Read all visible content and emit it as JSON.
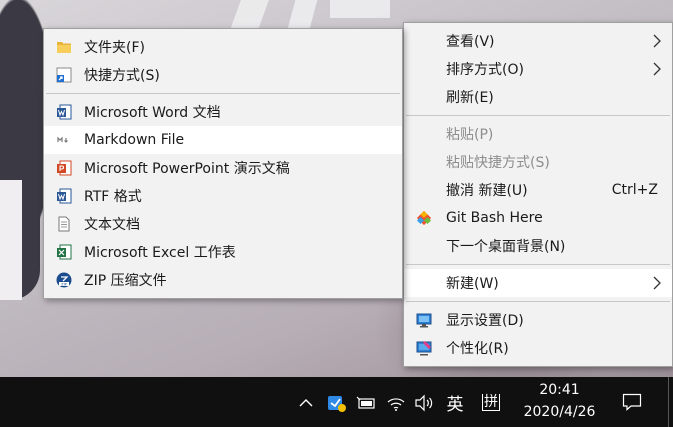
{
  "colors": {
    "menu_bg": "#f2f2f2",
    "menu_hover": "#ffffff",
    "disabled_text": "#8d8d8d",
    "taskbar_bg": "#101010"
  },
  "context_menu": {
    "items": [
      {
        "label": "查看(V)",
        "has_submenu": true
      },
      {
        "label": "排序方式(O)",
        "has_submenu": true
      },
      {
        "label": "刷新(E)"
      },
      {
        "label": "粘贴(P)",
        "disabled": true
      },
      {
        "label": "粘贴快捷方式(S)",
        "disabled": true
      },
      {
        "label": "撤消 新建(U)",
        "shortcut": "Ctrl+Z"
      },
      {
        "label": "Git Bash Here",
        "icon": "git-icon"
      },
      {
        "label": "下一个桌面背景(N)"
      },
      {
        "label": "新建(W)",
        "has_submenu": true,
        "highlighted": true
      },
      {
        "label": "显示设置(D)",
        "icon": "display-icon"
      },
      {
        "label": "个性化(R)",
        "icon": "personalize-icon"
      }
    ]
  },
  "new_submenu": {
    "items": [
      {
        "label": "文件夹(F)",
        "icon": "folder-icon"
      },
      {
        "label": "快捷方式(S)",
        "icon": "shortcut-icon"
      },
      {
        "label": "Microsoft Word 文档",
        "icon": "word-icon"
      },
      {
        "label": "Markdown File",
        "icon": "markdown-icon",
        "highlighted": true
      },
      {
        "label": "Microsoft PowerPoint 演示文稿",
        "icon": "powerpoint-icon"
      },
      {
        "label": "RTF 格式",
        "icon": "rtf-icon"
      },
      {
        "label": "文本文档",
        "icon": "text-document-icon"
      },
      {
        "label": "Microsoft Excel 工作表",
        "icon": "excel-icon"
      },
      {
        "label": "ZIP 压缩文件",
        "icon": "zip-icon"
      }
    ]
  },
  "taskbar": {
    "ime_language": "英",
    "ime_mode": "拼",
    "time": "20:41",
    "date": "2020/4/26"
  }
}
